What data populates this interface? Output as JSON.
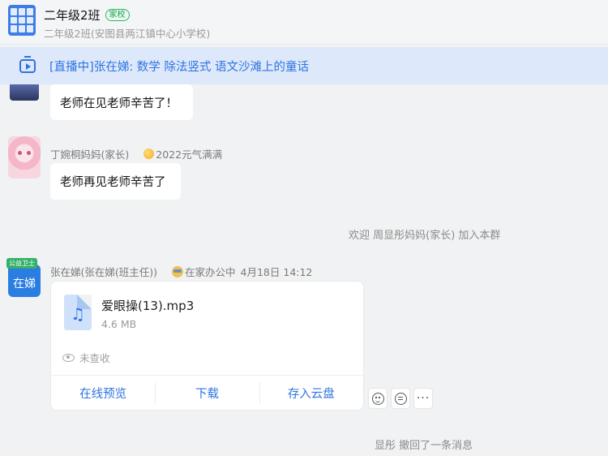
{
  "header": {
    "group_name": "二年级2班",
    "tag": "家校",
    "subtitle": "二年级2班(安图县两江镇中心小学校)"
  },
  "live_banner": {
    "text": "[直播中]张在娣: 数学 除法竖式 语文沙滩上的童话"
  },
  "messages": {
    "msg1_text": "老师在见老师辛苦了！",
    "msg2_sender": "丁婉桐妈妈(家长)",
    "msg2_badge": "2022元气满满",
    "msg2_text": "老师再见老师辛苦了",
    "system_join": "欢迎 周显彤妈妈(家长) 加入本群",
    "teacher_avatar_ribbon": "公益卫士",
    "teacher_avatar_name": "在娣",
    "teacher_sender": "张在娣(张在娣(班主任))",
    "teacher_status": "在家办公中",
    "teacher_time": "4月18日 14:12",
    "system_recall": "显彤 撤回了一条消息"
  },
  "file_card": {
    "file_name": "爱眼操(13).mp3",
    "file_size": "4.6 MB",
    "view_status": "未查收",
    "actions": [
      "在线预览",
      "下载",
      "存入云盘"
    ]
  },
  "icons": {
    "live": "live-tv-icon",
    "file": "music-file-icon",
    "eye": "eye-icon",
    "emoji": "emoji-reaction-icon",
    "quote": "quote-reply-icon",
    "more": "more-icon"
  },
  "colors": {
    "accent": "#2f73e0",
    "banner_bg": "#dde9fb",
    "tag_green": "#35b06a"
  }
}
